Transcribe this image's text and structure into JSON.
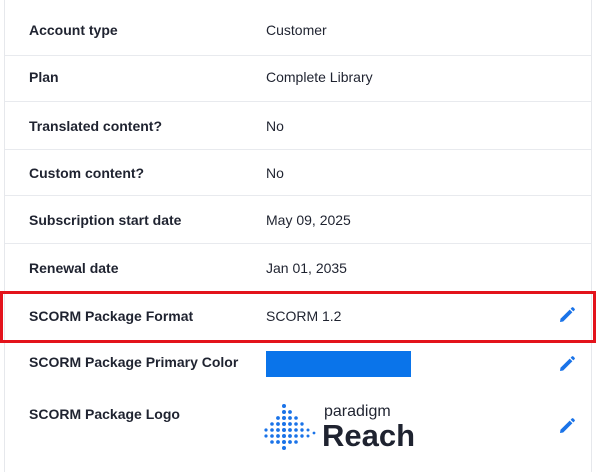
{
  "rows": [
    {
      "label": "Account type",
      "value": "Customer"
    },
    {
      "label": "Plan",
      "value": "Complete Library"
    },
    {
      "label": "Translated content?",
      "value": "No"
    },
    {
      "label": "Custom content?",
      "value": "No"
    },
    {
      "label": "Subscription start date",
      "value": "May 09, 2025"
    },
    {
      "label": "Renewal date",
      "value": "Jan 01, 2035"
    },
    {
      "label": "SCORM Package Format",
      "value": "SCORM 1.2"
    },
    {
      "label": "SCORM Package Primary Color",
      "value": "#0a74ea"
    },
    {
      "label": "SCORM Package Logo"
    }
  ],
  "logo": {
    "brand_small": "paradigm",
    "brand_large": "Reach"
  },
  "colors": {
    "primary": "#0a74ea",
    "edit_icon": "#1a73e8",
    "highlight": "#e3131b"
  },
  "icons": {
    "edit": "pencil-icon"
  }
}
